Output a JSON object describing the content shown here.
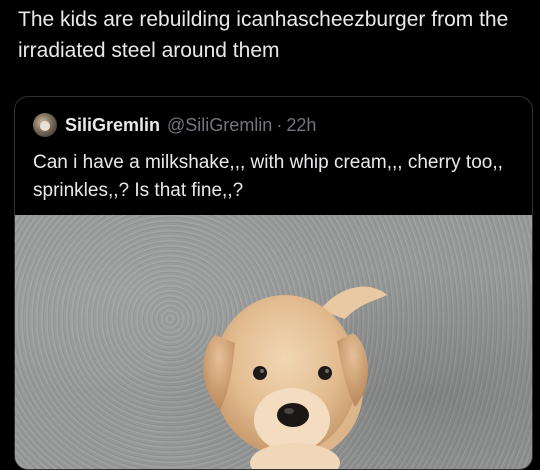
{
  "post": {
    "text": "The kids are rebuilding icanhascheezburger from the irradiated steel around them"
  },
  "quoted_post": {
    "display_name": "SiliGremlin",
    "handle": "@SiliGremlin",
    "separator": "·",
    "time": "22h",
    "text": "Can i have a milkshake,,, with whip cream,,, cherry too,, sprinkles,,? Is that fine,,?",
    "media_description_icon": "puppy-photo"
  }
}
